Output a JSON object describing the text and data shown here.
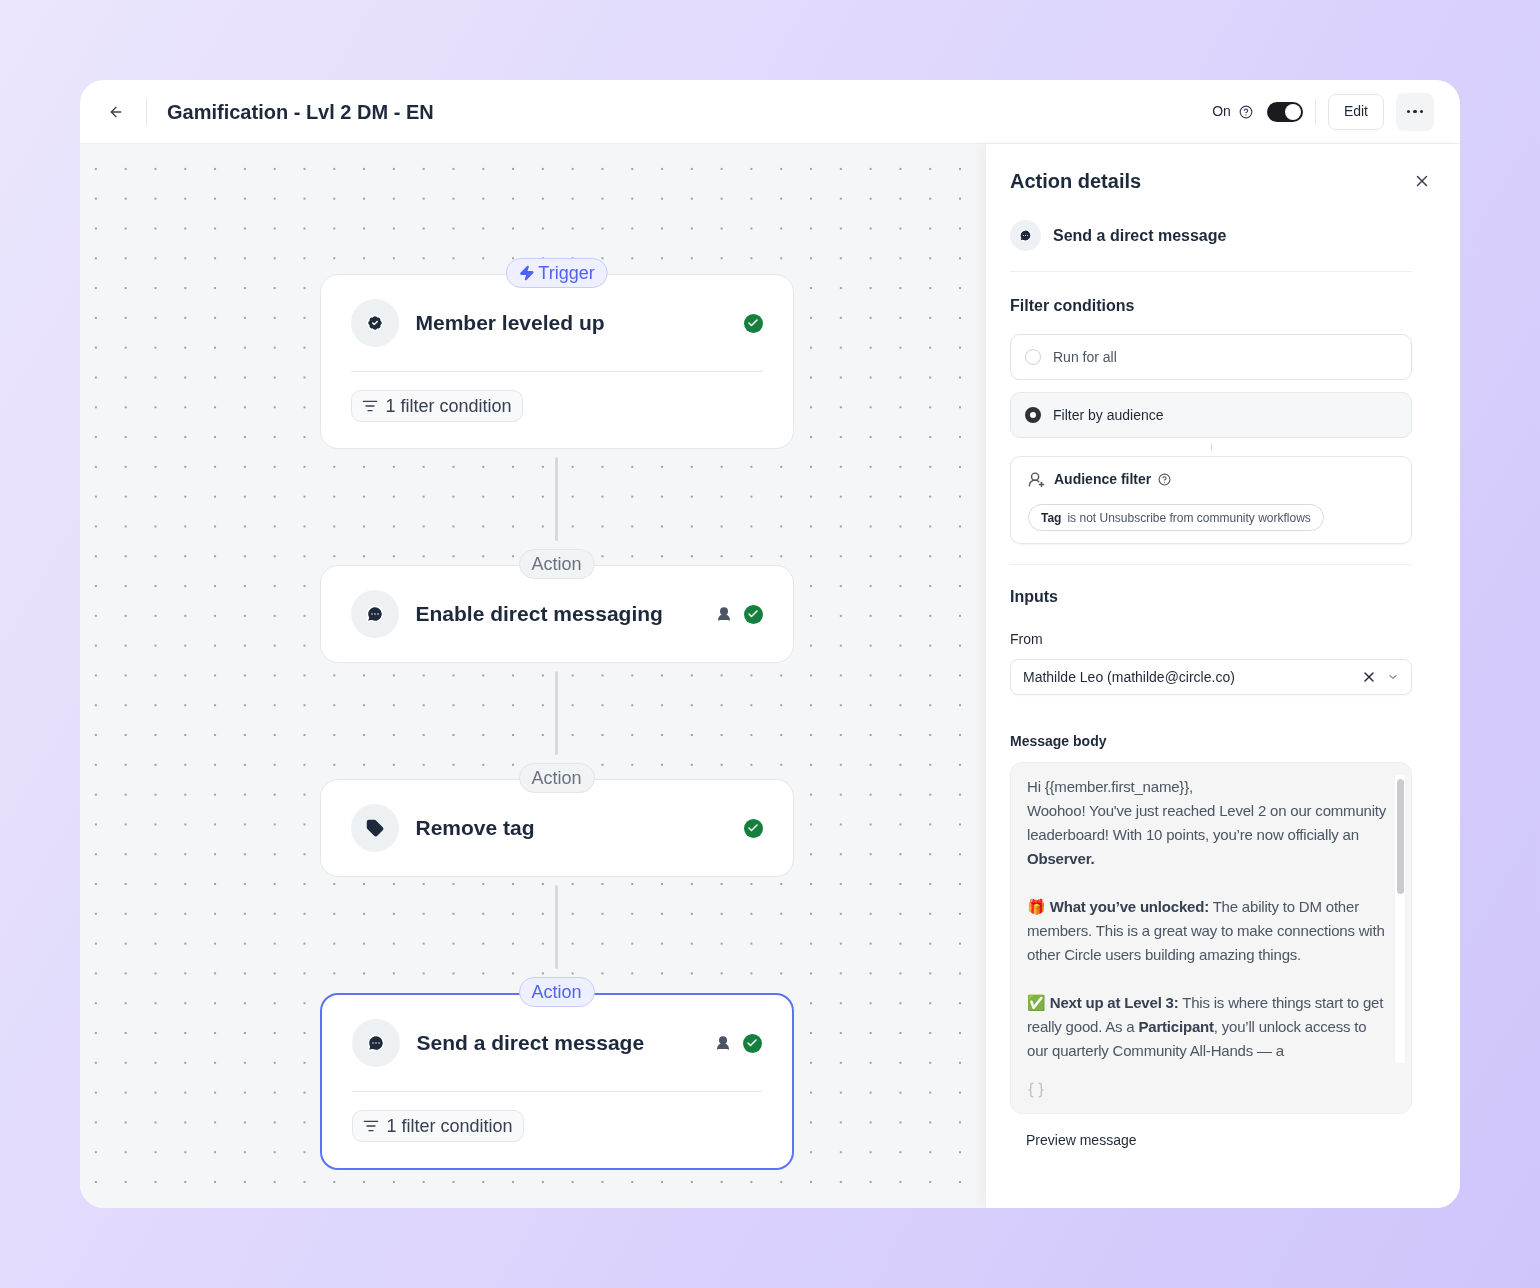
{
  "header": {
    "title": "Gamification - Lvl 2 DM - EN",
    "status_label": "On",
    "on": true,
    "edit_button": "Edit"
  },
  "nodes": [
    {
      "badge": "Trigger",
      "kind": "trigger",
      "title": "Member leveled up",
      "has_user": false,
      "done": true,
      "filter": "1 filter condition",
      "selected": false
    },
    {
      "badge": "Action",
      "kind": "action",
      "title": "Enable direct messaging",
      "has_user": true,
      "done": true,
      "selected": false
    },
    {
      "badge": "Action",
      "kind": "action",
      "title": "Remove tag",
      "has_user": false,
      "done": true,
      "selected": false
    },
    {
      "badge": "Action",
      "kind": "action",
      "title": "Send a direct message",
      "has_user": true,
      "done": true,
      "filter": "1 filter condition",
      "selected": true
    }
  ],
  "panel": {
    "title": "Action details",
    "action": "Send a direct message",
    "filter_heading": "Filter conditions",
    "options": [
      {
        "label": "Run for all",
        "selected": false
      },
      {
        "label": "Filter by audience",
        "selected": true
      }
    ],
    "audience_filter": {
      "title": "Audience filter",
      "chip_key": "Tag",
      "chip_value": "is not Unsubscribe from community workflows"
    },
    "inputs_heading": "Inputs",
    "from_label": "From",
    "from_value": "Mathilde Leo (mathilde@circle.co)",
    "message_label": "Message body",
    "message_paragraphs": [
      "Hi {{member.first_name}},\nWoohoo! You've just reached Level 2 on our community leaderboard! With 10 points, you’re now officially an **Observer.**",
      "🎁 **What you’ve unlocked:** The ability to DM other members. This is a great way to make connections with other Circle users building amazing things.",
      "✅ **Next up at Level 3:** This is where things start to get really good. As a **Participant**, you’ll unlock access to our quarterly Community All-Hands — a"
    ],
    "preview": "Preview message"
  }
}
